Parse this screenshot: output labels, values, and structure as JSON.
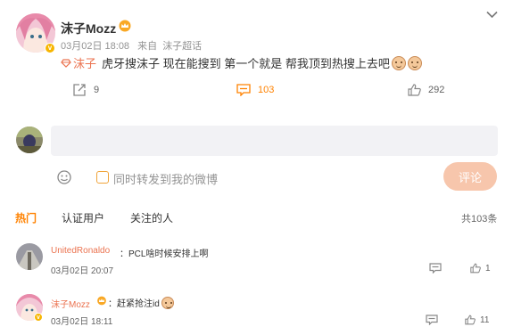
{
  "post": {
    "author": "沫子Mozz",
    "time": "03月02日 18:08",
    "source_prefix": "来自",
    "source": "沫子超话",
    "mention": "沫子",
    "text": "虎牙搜沫子 现在能搜到 第一个就是 帮我顶到热搜上去吧",
    "repost_count": "9",
    "comment_count": "103",
    "like_count": "292"
  },
  "composer": {
    "placeholder": "",
    "repost_label": "同时转发到我的微博",
    "submit_label": "评论"
  },
  "tabs": {
    "hot": "热门",
    "verified": "认证用户",
    "following": "关注的人",
    "total": "共103条"
  },
  "comments": [
    {
      "author": "UnitedRonaldo",
      "text": "：PCL啥时候安排上啊",
      "time": "03月02日 20:07",
      "like_count": "1"
    },
    {
      "author": "沫子Mozz",
      "text": "：赶紧抢注id",
      "time": "03月02日 18:11",
      "like_count": "11"
    }
  ],
  "colors": {
    "accent": "#ff8200",
    "link": "#eb7350",
    "submit_disabled": "#f7c6ac",
    "input_bg": "#f2f2f5"
  },
  "icons": [
    "chevron-down-icon",
    "repost-icon",
    "comment-icon",
    "like-icon",
    "smile-icon",
    "crown-icon",
    "verified-icon",
    "mention-icon"
  ]
}
